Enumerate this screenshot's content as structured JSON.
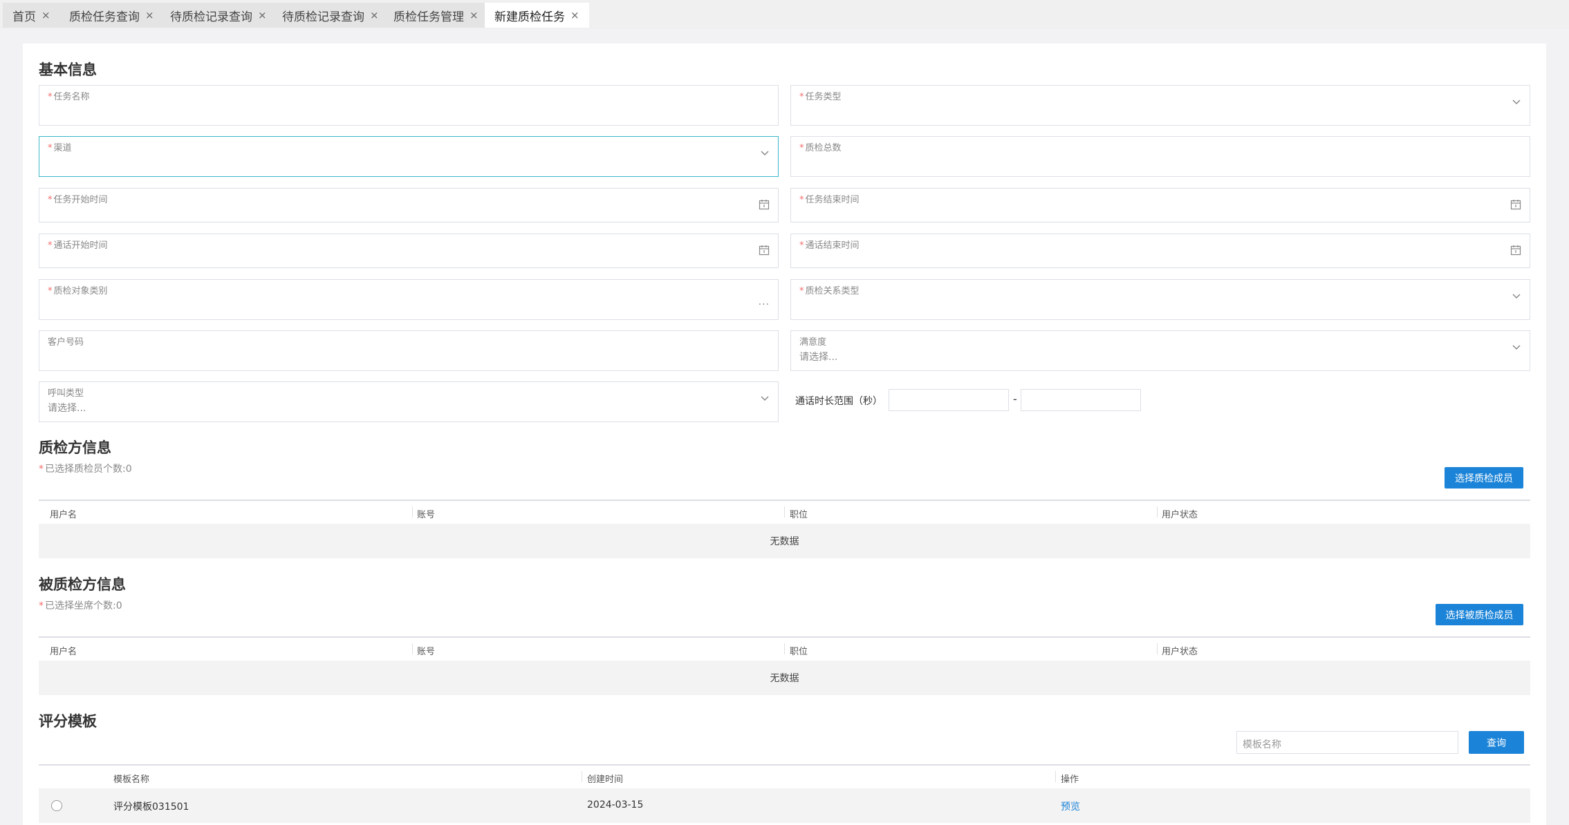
{
  "tabs": [
    {
      "label": "首页"
    },
    {
      "label": "质检任务查询"
    },
    {
      "label": "待质检记录查询"
    },
    {
      "label": "待质检记录查询"
    },
    {
      "label": "质检任务管理"
    },
    {
      "label": "新建质检任务"
    }
  ],
  "tab_close": "×",
  "basic": {
    "title": "基本信息",
    "req_mark": "*",
    "task_name": "任务名称",
    "task_type": "任务类型",
    "channel": "渠道",
    "qc_total": "质检总数",
    "task_start": "任务开始时间",
    "task_end": "任务结束时间",
    "call_start": "通话开始时间",
    "call_end": "通话结束时间",
    "object_type": "质检对象类别",
    "relation_type": "质检关系类型",
    "customer_no": "客户号码",
    "satisfaction": "满意度",
    "satisfaction_ph": "请选择...",
    "call_type": "呼叫类型",
    "call_type_ph": "请选择...",
    "duration_label": "通话时长范围（秒）",
    "duration_dash": "-",
    "dots": "..."
  },
  "inspector": {
    "title": "质检方信息",
    "count": "已选择质检员个数:0",
    "button": "选择质检成员",
    "columns": [
      "用户名",
      "账号",
      "职位",
      "用户状态"
    ],
    "empty": "无数据"
  },
  "inspected": {
    "title": "被质检方信息",
    "count": "已选择坐席个数:0",
    "button": "选择被质检成员",
    "columns": [
      "用户名",
      "账号",
      "职位",
      "用户状态"
    ],
    "empty": "无数据"
  },
  "template": {
    "title": "评分模板",
    "search_placeholder": "模板名称",
    "search_button": "查询",
    "columns": [
      "模板名称",
      "创建时间",
      "操作"
    ],
    "rows": [
      {
        "name": "评分模板031501",
        "created": "2024-03-15",
        "action": "预览"
      }
    ]
  },
  "icons": {
    "chevron": "chevron-down-icon",
    "calendar": "calendar-icon",
    "radio": "radio-icon",
    "close": "close-icon"
  },
  "colors": {
    "primary": "#1c84d8",
    "required": "#f56c6c",
    "focus": "#39b7c9"
  }
}
